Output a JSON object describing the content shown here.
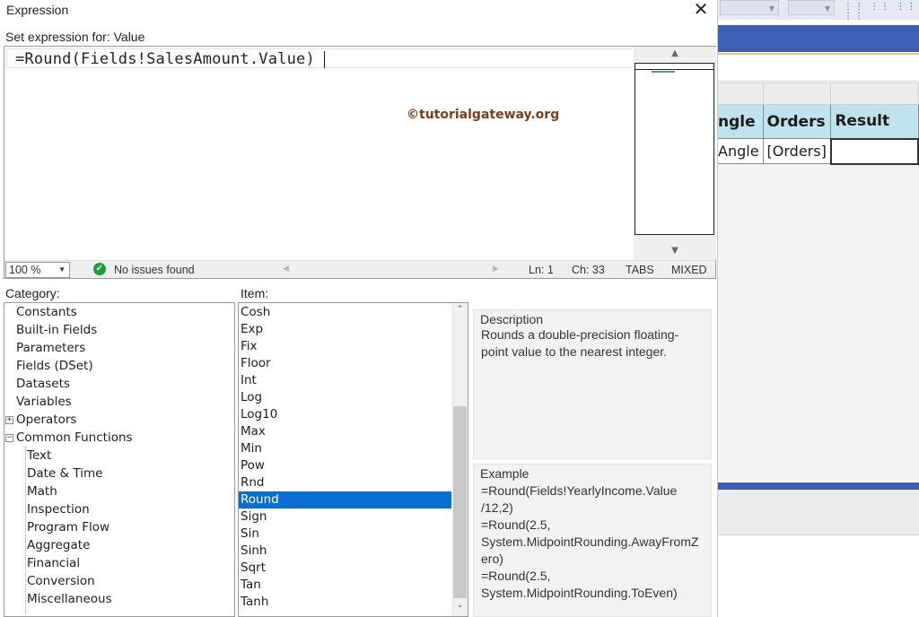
{
  "dialog": {
    "title": "Expression",
    "set_label": "Set expression for: Value",
    "expression": "=Round(Fields!SalesAmount.Value)",
    "watermark": "©tutorialgateway.org"
  },
  "status": {
    "zoom": "100 %",
    "issues": "No issues found",
    "line": "Ln: 1",
    "col": "Ch: 33",
    "tabs": "TABS",
    "eol": "MIXED"
  },
  "category": {
    "label": "Category:",
    "items": [
      {
        "label": "Constants"
      },
      {
        "label": "Built-in Fields"
      },
      {
        "label": "Parameters"
      },
      {
        "label": "Fields (DSet)"
      },
      {
        "label": "Datasets"
      },
      {
        "label": "Variables"
      },
      {
        "label": "Operators"
      },
      {
        "label": "Common Functions"
      },
      {
        "label": "Text"
      },
      {
        "label": "Date & Time"
      },
      {
        "label": "Math"
      },
      {
        "label": "Inspection"
      },
      {
        "label": "Program Flow"
      },
      {
        "label": "Aggregate"
      },
      {
        "label": "Financial"
      },
      {
        "label": "Conversion"
      },
      {
        "label": "Miscellaneous"
      }
    ]
  },
  "item": {
    "label": "Item:",
    "items": [
      "Cosh",
      "Exp",
      "Fix",
      "Floor",
      "Int",
      "Log",
      "Log10",
      "Max",
      "Min",
      "Pow",
      "Rnd",
      "Round",
      "Sign",
      "Sin",
      "Sinh",
      "Sqrt",
      "Tan",
      "Tanh"
    ],
    "selected": "Round"
  },
  "description": {
    "title": "Description",
    "text": "Rounds a double-precision floating-point value to the nearest integer."
  },
  "example": {
    "title": "Example",
    "lines": [
      "=Round(Fields!YearlyIncome.Value",
      "/12,2)",
      "=Round(2.5,",
      "System.MidpointRounding.AwayFromZ",
      "ero)",
      "=Round(2.5,",
      "System.MidpointRounding.ToEven)"
    ]
  },
  "background": {
    "table_headers": [
      "ngle",
      "Orders",
      "Result"
    ],
    "table_row": [
      "Angle",
      "[Orders]",
      ""
    ],
    "accent_blue": "#3e5fb5",
    "header_fill": "#bfe3ec"
  }
}
